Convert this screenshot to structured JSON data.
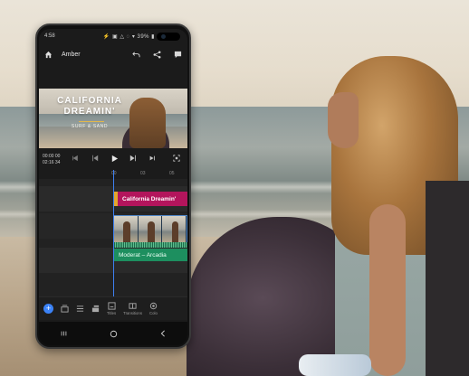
{
  "status_bar": {
    "time": "4:58",
    "indicators": "⚡ ▣ △ ◌  ▾ 39% ▮"
  },
  "app_bar": {
    "home_icon": "home-icon",
    "project_title": "Amber",
    "actions": [
      "undo-icon",
      "share-icon",
      "comment-icon"
    ]
  },
  "preview": {
    "title_line1": "CALIFORNIA",
    "title_line2": "DREAMIN'",
    "subtitle": "SURF & SAND"
  },
  "transport": {
    "current_time": "00:00",
    "frames": "00",
    "total_time": "02:16",
    "total_frames": "34",
    "controls": [
      "previous-marker-icon",
      "step-back-icon",
      "play-icon",
      "step-forward-icon",
      "next-marker-icon",
      "fullscreen-icon"
    ]
  },
  "ruler": {
    "ticks": [
      "00",
      "03",
      "05"
    ]
  },
  "timeline": {
    "title_clip": "California Dreamin'",
    "audio_clip": "Moderat – Arcadia"
  },
  "toolbar": {
    "add_label": "+",
    "tools": [
      {
        "name": "media-tool",
        "label": ""
      },
      {
        "name": "list-tool",
        "label": ""
      },
      {
        "name": "layers-tool",
        "label": ""
      },
      {
        "name": "titles-tool",
        "label": "Titles"
      },
      {
        "name": "transitions-tool",
        "label": "Transitions"
      },
      {
        "name": "color-tool",
        "label": "Colo"
      }
    ]
  },
  "nav_bar": [
    "recent-apps-icon",
    "home-circle-icon",
    "back-icon"
  ],
  "colors": {
    "accent_blue": "#3b82f6",
    "title_clip": "#b3155c",
    "title_clip_handle": "#e3a62e",
    "audio_clip": "#1d8f5f",
    "video_clip_border": "#4f87c7"
  }
}
